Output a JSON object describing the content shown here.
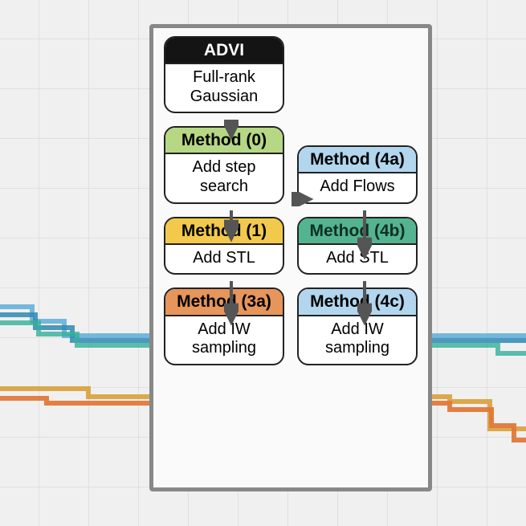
{
  "advi": {
    "head": "ADVI",
    "body": "Full-rank Gaussian"
  },
  "m0": {
    "head": "Method (0)",
    "body": "Add step search"
  },
  "m1": {
    "head": "Method (1)",
    "body": "Add STL"
  },
  "m3a": {
    "head": "Method (3a)",
    "body": "Add IW sampling"
  },
  "m4a": {
    "head": "Method (4a)",
    "body": "Add Flows"
  },
  "m4b": {
    "head": "Method (4b)",
    "body": "Add STL"
  },
  "m4c": {
    "head": "Method (4c)",
    "body": "Add IW sampling"
  },
  "bg_colors": {
    "line1": "#4aa6d6",
    "line2": "#2f8ab3",
    "line3": "#35b09a",
    "line4": "#d9a03a",
    "line5": "#e07838"
  }
}
